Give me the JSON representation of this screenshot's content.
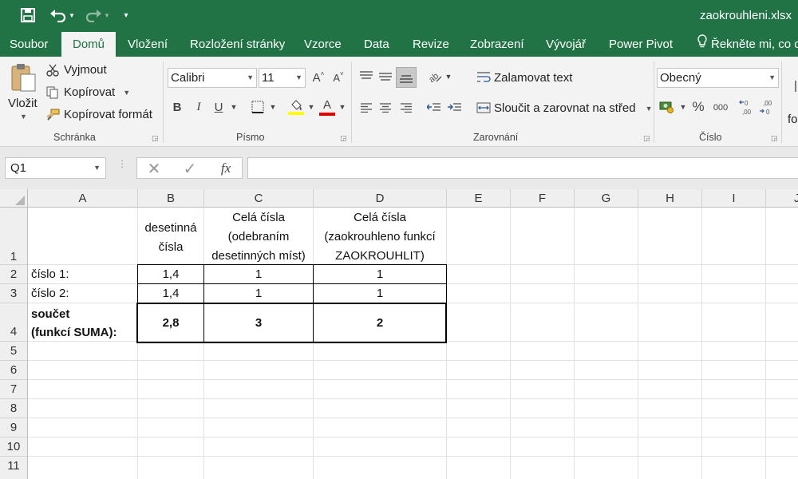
{
  "window": {
    "filename": "zaokrouhleni.xlsx"
  },
  "ribbon_tabs": [
    "Soubor",
    "Domů",
    "Vložení",
    "Rozložení stránky",
    "Vzorce",
    "Data",
    "Revize",
    "Zobrazení",
    "Vývojář",
    "Power Pivot"
  ],
  "tell_me": "Řekněte mi, co c",
  "clipboard": {
    "paste": "Vložit",
    "cut": "Vyjmout",
    "copy": "Kopírovat",
    "format_painter": "Kopírovat formát",
    "group": "Schránka"
  },
  "font": {
    "name": "Calibri",
    "size": "11",
    "group": "Písmo",
    "bold": "B",
    "italic": "I",
    "underline": "U",
    "grow": "A",
    "shrink": "A",
    "color_letter": "A",
    "highlight_color": "#ffff00",
    "font_color": "#ff0000"
  },
  "alignment": {
    "wrap_text": "Zalamovat text",
    "merge_center": "Sloučit a zarovnat na střed",
    "group": "Zarovnání"
  },
  "number": {
    "format": "Obecný",
    "group": "Číslo",
    "percent": "%",
    "thousands": "000",
    "styles_partial": "fo"
  },
  "formula_bar": {
    "name_box": "Q1",
    "fx": "fx",
    "formula": ""
  },
  "sheet": {
    "columns": [
      "A",
      "B",
      "C",
      "D",
      "E",
      "F",
      "G",
      "H",
      "I",
      "J"
    ],
    "rows": [
      "1",
      "2",
      "3",
      "4",
      "5",
      "6",
      "7",
      "8",
      "9",
      "10",
      "11"
    ],
    "headers": {
      "b1": [
        "desetinná",
        "čísla"
      ],
      "c1": [
        "Celá čísla",
        "(odebraním",
        "desetinných míst)"
      ],
      "d1": [
        "Celá čísla",
        "(zaokrouhleno funkcí",
        "ZAOKROUHLIT)"
      ]
    },
    "row2": {
      "label": "číslo 1:",
      "b": "1,4",
      "c": "1",
      "d": "1"
    },
    "row3": {
      "label": "číslo 2:",
      "b": "1,4",
      "c": "1",
      "d": "1"
    },
    "row4": {
      "label1": "součet",
      "label2": "(funkcí SUMA):",
      "b": "2,8",
      "c": "3",
      "d": "2"
    }
  }
}
